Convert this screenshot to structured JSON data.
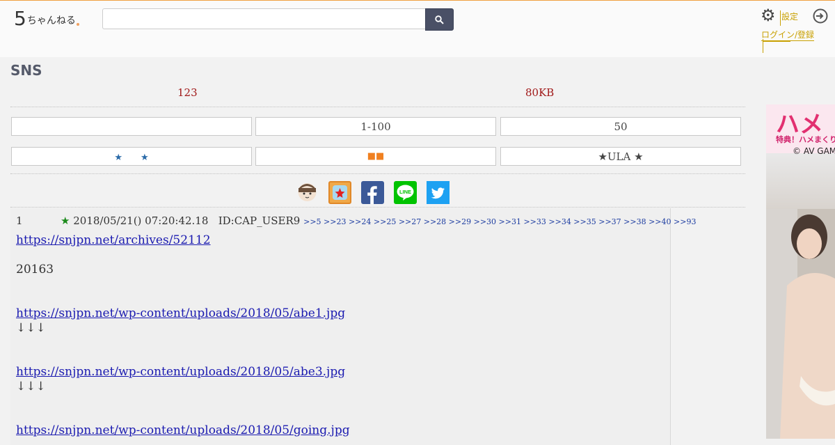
{
  "header": {
    "logo_five": "5",
    "logo_kana": "ちゃんねる",
    "search_placeholder": "",
    "gear_label": "設定",
    "gear_sub": "ログイン/登録"
  },
  "main": {
    "title": "SNS",
    "res_count": "123",
    "size": "80KB"
  },
  "nav": {
    "row1": [
      "",
      "1-100",
      "50"
    ],
    "row2": [
      "★　　★",
      "■■",
      "★ULA ★"
    ]
  },
  "share_icons": [
    "5ch-avatar-icon",
    "bookmark-icon",
    "facebook-icon",
    "line-icon",
    "twitter-icon"
  ],
  "post": {
    "number": "1",
    "date": "2018/05/21() 07:20:42.18",
    "id": "ID:CAP_USER9",
    "refs": ">>5 >>23 >>24 >>25 >>27 >>28 >>29 >>30 >>31 >>33 >>34 >>35 >>37 >>38 >>40 >>93",
    "link1": "https://snjpn.net/archives/52112",
    "text1": "20163",
    "link2": "https://snjpn.net/wp-content/uploads/2018/05/abe1.jpg",
    "arrows1": "↓↓↓",
    "link3": "https://snjpn.net/wp-content/uploads/2018/05/abe3.jpg",
    "arrows2": "↓↓↓",
    "link4": "https://snjpn.net/wp-content/uploads/2018/05/going.jpg"
  },
  "ad": {
    "caption": "特典！ハメまくり",
    "copyright": "© AV GAM"
  },
  "colors": {
    "accent": "#f0a040",
    "stat_red": "#a01818",
    "search_btn": "#4a5066",
    "facebook": "#3b5998",
    "line": "#00c300",
    "twitter": "#1da1f2"
  }
}
